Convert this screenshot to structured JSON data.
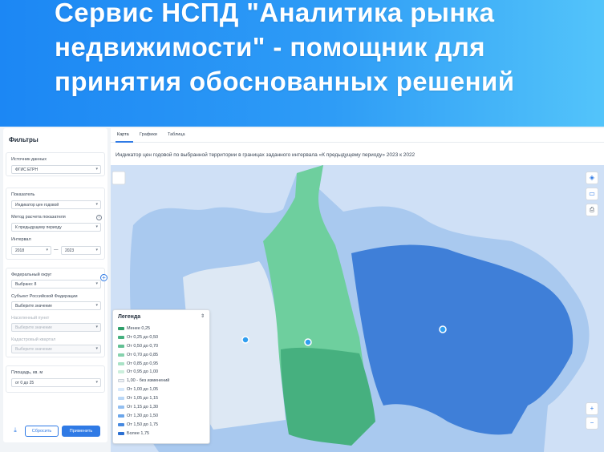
{
  "headline": "Сервис НСПД \"Аналитика рынка недвижимости\" - помощник для принятия обоснованных решений",
  "filters": {
    "title": "Фильтры",
    "source_label": "Источник данных",
    "source_value": "ФГИС ЕГРН",
    "indicator_label": "Показатель",
    "indicator_value": "Индикатор цен годовой",
    "method_label": "Метод расчета показателя",
    "method_value": "К предыдущему периоду",
    "interval_label": "Интервал",
    "interval_from": "2018",
    "interval_sep": "—",
    "interval_to": "2023",
    "district_label": "Федеральный округ",
    "district_value": "Выбрано: 8",
    "subject_label": "Субъект Российской Федерации",
    "subject_placeholder": "Выберите значение",
    "locality_label": "Населенный пункт",
    "locality_placeholder": "Выберите значение",
    "quarter_label": "Кадастровый квартал",
    "quarter_placeholder": "Выберите значение",
    "area_label": "Площадь, кв. м",
    "area_value": "от 0 до 25",
    "reset_label": "Сбросить",
    "apply_label": "Применить"
  },
  "tabs": [
    {
      "label": "Карта",
      "active": true
    },
    {
      "label": "Графики",
      "active": false
    },
    {
      "label": "Таблица",
      "active": false
    }
  ],
  "subtitle": "Индикатор цен годовой по выбранной территории в границах заданного интервала «К предыдущему периоду» 2023 к 2022",
  "legend": {
    "title": "Легенда",
    "items": [
      {
        "label": "Менее 0,25",
        "color": "#2f9f6a"
      },
      {
        "label": "От 0,25 до 0,50",
        "color": "#46b07f"
      },
      {
        "label": "От 0,50 до 0,70",
        "color": "#62c094"
      },
      {
        "label": "От 0,70 до 0,85",
        "color": "#86d2ad"
      },
      {
        "label": "От 0,85 до 0,95",
        "color": "#a9e2c6"
      },
      {
        "label": "От 0,95 до 1,00",
        "color": "#cbefdc"
      },
      {
        "label": "1,00 - без изменений",
        "color": "#eef1f4"
      },
      {
        "label": "От 1,00 до 1,05",
        "color": "#d6e8fb"
      },
      {
        "label": "От 1,05 до 1,15",
        "color": "#b9d7f7"
      },
      {
        "label": "От 1,15 до 1,30",
        "color": "#93bff1"
      },
      {
        "label": "От 1,30 до 1,50",
        "color": "#6aa5ea"
      },
      {
        "label": "От 1,50 до 1,75",
        "color": "#4789e0"
      },
      {
        "label": "Более 1,75",
        "color": "#2b6fd2"
      }
    ]
  },
  "map_controls": {
    "layers_icon": "layers-icon",
    "ruler_icon": "ruler-icon",
    "print_icon": "print-icon",
    "zoom_in": "+",
    "zoom_out": "−"
  },
  "colors": {
    "accent": "#2f7ae5",
    "banner_start": "#1c87f4",
    "banner_end": "#53c4fa"
  }
}
